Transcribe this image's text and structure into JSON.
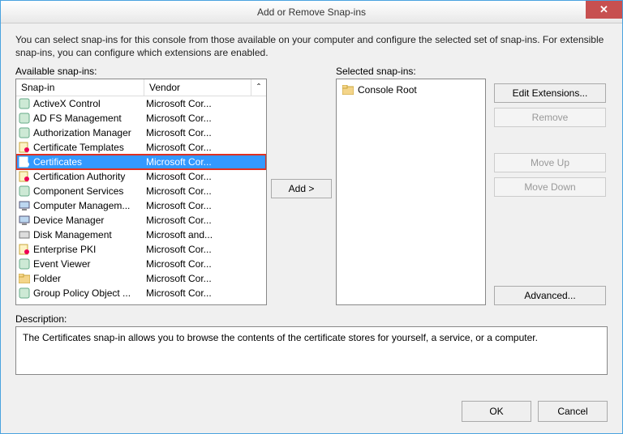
{
  "window": {
    "title": "Add or Remove Snap-ins",
    "close_symbol": "✕"
  },
  "intro": "You can select snap-ins for this console from those available on your computer and configure the selected set of snap-ins. For extensible snap-ins, you can configure which extensions are enabled.",
  "labels": {
    "available": "Available snap-ins:",
    "selected": "Selected snap-ins:",
    "description": "Description:"
  },
  "headers": {
    "snapin": "Snap-in",
    "vendor": "Vendor",
    "chevron": "ˆ"
  },
  "buttons": {
    "add": "Add >",
    "edit_ext": "Edit Extensions...",
    "remove": "Remove",
    "move_up": "Move Up",
    "move_down": "Move Down",
    "advanced": "Advanced...",
    "ok": "OK",
    "cancel": "Cancel"
  },
  "selected_root": "Console Root",
  "description_text": "The Certificates snap-in allows you to browse the contents of the certificate stores for yourself, a service, or a computer.",
  "available": [
    {
      "name": "ActiveX Control",
      "vendor": "Microsoft Cor...",
      "icon": "gear"
    },
    {
      "name": "AD FS Management",
      "vendor": "Microsoft Cor...",
      "icon": "adfs"
    },
    {
      "name": "Authorization Manager",
      "vendor": "Microsoft Cor...",
      "icon": "auth"
    },
    {
      "name": "Certificate Templates",
      "vendor": "Microsoft Cor...",
      "icon": "cert-tpl"
    },
    {
      "name": "Certificates",
      "vendor": "Microsoft Cor...",
      "icon": "cert",
      "selected": true,
      "highlighted": true
    },
    {
      "name": "Certification Authority",
      "vendor": "Microsoft Cor...",
      "icon": "ca"
    },
    {
      "name": "Component Services",
      "vendor": "Microsoft Cor...",
      "icon": "comp"
    },
    {
      "name": "Computer Managem...",
      "vendor": "Microsoft Cor...",
      "icon": "computer"
    },
    {
      "name": "Device Manager",
      "vendor": "Microsoft Cor...",
      "icon": "device"
    },
    {
      "name": "Disk Management",
      "vendor": "Microsoft and...",
      "icon": "disk"
    },
    {
      "name": "Enterprise PKI",
      "vendor": "Microsoft Cor...",
      "icon": "pki"
    },
    {
      "name": "Event Viewer",
      "vendor": "Microsoft Cor...",
      "icon": "event"
    },
    {
      "name": "Folder",
      "vendor": "Microsoft Cor...",
      "icon": "folder"
    },
    {
      "name": "Group Policy Object ...",
      "vendor": "Microsoft Cor...",
      "icon": "gpo"
    }
  ],
  "colors": {
    "selection": "#3399ff",
    "highlight_outline": "#e03020",
    "close_bg": "#c75050"
  }
}
